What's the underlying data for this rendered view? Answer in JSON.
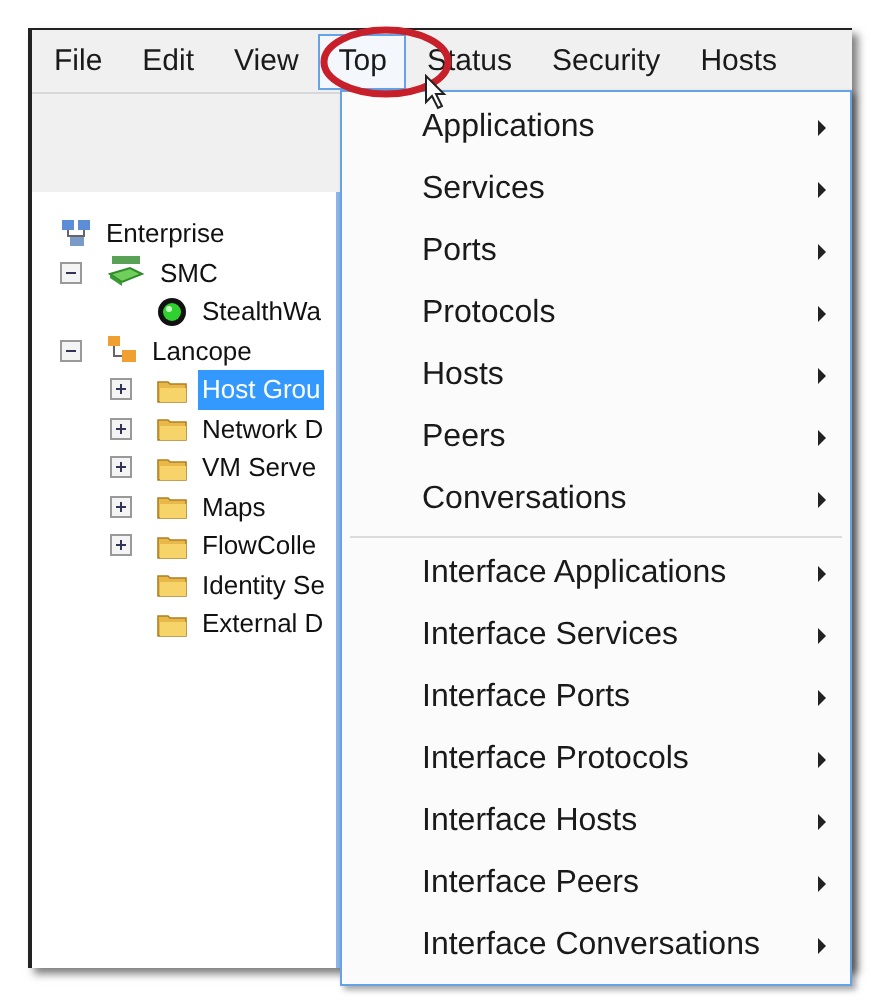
{
  "menubar": [
    {
      "label": "File",
      "selected": false
    },
    {
      "label": "Edit",
      "selected": false
    },
    {
      "label": "View",
      "selected": false
    },
    {
      "label": "Top",
      "selected": true
    },
    {
      "label": "Status",
      "selected": false
    },
    {
      "label": "Security",
      "selected": false
    },
    {
      "label": "Hosts",
      "selected": false
    }
  ],
  "tree": [
    {
      "label": "Enterprise",
      "kind": "enterprise",
      "selected": false,
      "children": [
        {
          "label": "SMC",
          "kind": "smc",
          "selected": false,
          "expanded": true,
          "children": [
            {
              "label": "StealthWa",
              "kind": "appliance",
              "selected": false
            }
          ]
        },
        {
          "label": "Lancope",
          "kind": "domain",
          "selected": false,
          "expanded": true,
          "children": [
            {
              "label": "Host Grou",
              "kind": "folder",
              "selected": true,
              "expanded": false
            },
            {
              "label": "Network D",
              "kind": "folder",
              "selected": false,
              "expanded": false
            },
            {
              "label": "VM Serve",
              "kind": "folder",
              "selected": false,
              "expanded": false
            },
            {
              "label": "Maps",
              "kind": "folder",
              "selected": false,
              "expanded": false
            },
            {
              "label": "FlowColle",
              "kind": "folder",
              "selected": false,
              "expanded": false
            },
            {
              "label": "Identity Se",
              "kind": "folder",
              "selected": false
            },
            {
              "label": "External D",
              "kind": "folder",
              "selected": false
            }
          ]
        }
      ]
    }
  ],
  "dropdown": {
    "groups": [
      [
        {
          "label": "Applications",
          "submenu": true
        },
        {
          "label": "Services",
          "submenu": true
        },
        {
          "label": "Ports",
          "submenu": true
        },
        {
          "label": "Protocols",
          "submenu": true
        },
        {
          "label": "Hosts",
          "submenu": true
        },
        {
          "label": "Peers",
          "submenu": true
        },
        {
          "label": "Conversations",
          "submenu": true
        }
      ],
      [
        {
          "label": "Interface Applications",
          "submenu": true
        },
        {
          "label": "Interface Services",
          "submenu": true
        },
        {
          "label": "Interface Ports",
          "submenu": true
        },
        {
          "label": "Interface Protocols",
          "submenu": true
        },
        {
          "label": "Interface Hosts",
          "submenu": true
        },
        {
          "label": "Interface Peers",
          "submenu": true
        },
        {
          "label": "Interface Conversations",
          "submenu": true
        }
      ]
    ]
  }
}
